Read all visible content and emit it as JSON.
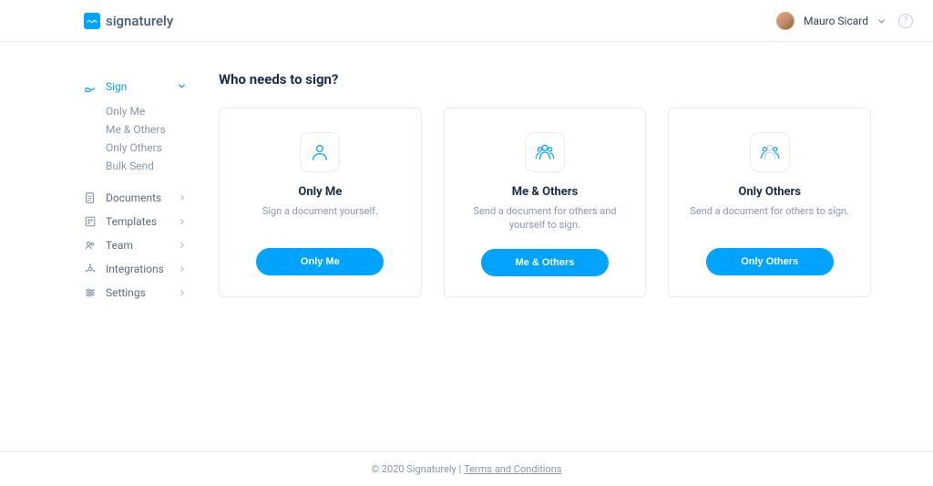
{
  "brand": {
    "name": "signaturely"
  },
  "user": {
    "name": "Mauro Sicard"
  },
  "sidebar": {
    "sign": {
      "label": "Sign",
      "sub": [
        {
          "label": "Only Me"
        },
        {
          "label": "Me & Others"
        },
        {
          "label": "Only Others"
        },
        {
          "label": "Bulk Send"
        }
      ]
    },
    "items": [
      {
        "label": "Documents"
      },
      {
        "label": "Templates"
      },
      {
        "label": "Team"
      },
      {
        "label": "Integrations"
      },
      {
        "label": "Settings"
      }
    ]
  },
  "main": {
    "title": "Who needs to sign?",
    "cards": [
      {
        "title": "Only Me",
        "desc": "Sign a document yourself.",
        "button": "Only Me"
      },
      {
        "title": "Me & Others",
        "desc": "Send a document for others and yourself to sign.",
        "button": "Me & Others"
      },
      {
        "title": "Only Others",
        "desc": "Send a document for others to sign.",
        "button": "Only Others"
      }
    ]
  },
  "footer": {
    "copyright": "© 2020 Signaturely |",
    "terms": "Terms and Conditions"
  }
}
